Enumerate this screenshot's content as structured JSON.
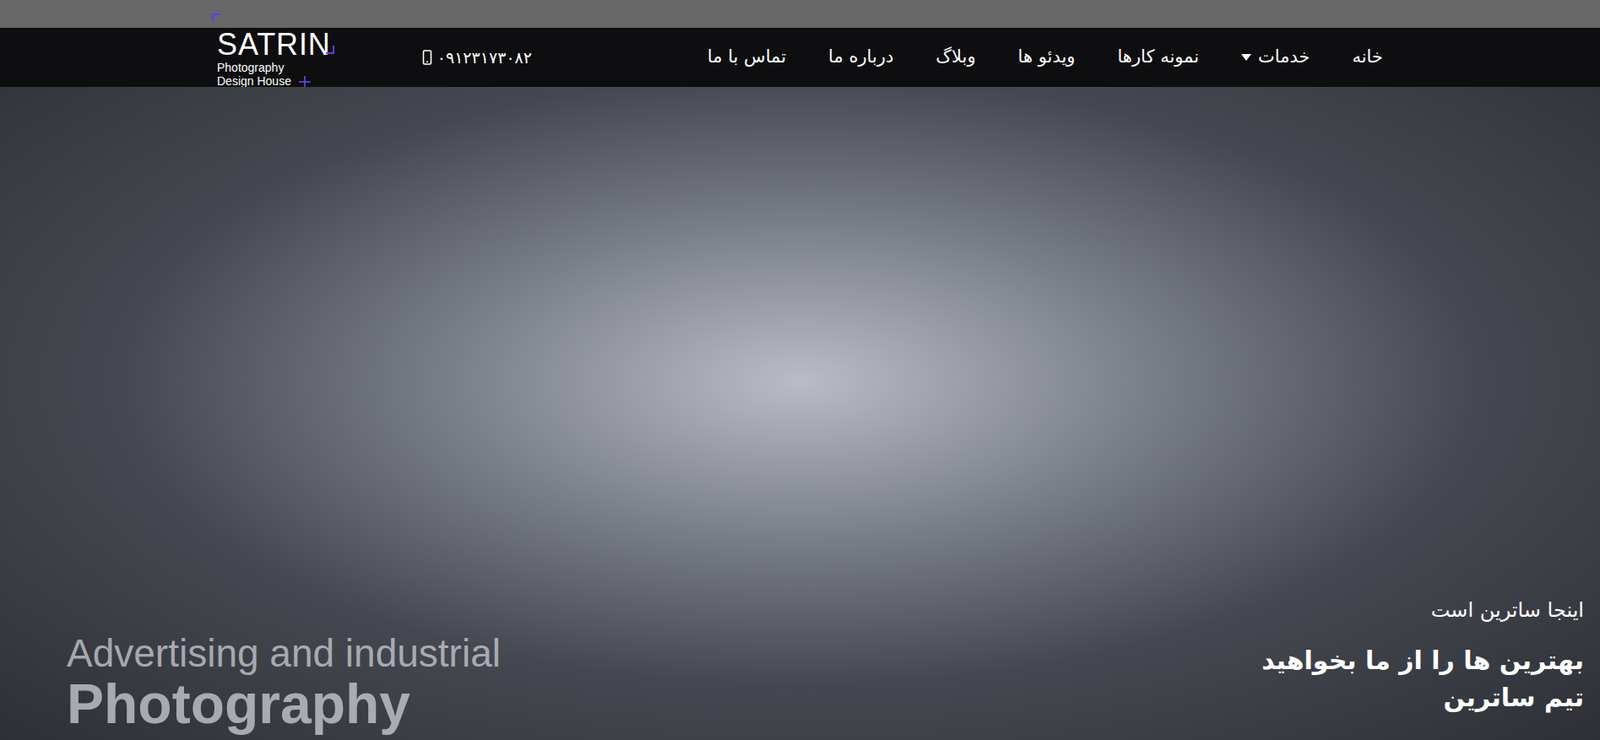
{
  "logo": {
    "name": "SATRIN",
    "tagline": [
      "Photography",
      "Design House"
    ]
  },
  "phone": "۰۹۱۲۳۱۷۳۰۸۲",
  "nav": [
    {
      "label": "خانه",
      "dropdown": false
    },
    {
      "label": "خدمات",
      "dropdown": true
    },
    {
      "label": "نمونه کارها",
      "dropdown": false
    },
    {
      "label": "ویدئو ها",
      "dropdown": false
    },
    {
      "label": "وبلاگ",
      "dropdown": false
    },
    {
      "label": "درباره ما",
      "dropdown": false
    },
    {
      "label": "تماس با ما",
      "dropdown": false
    }
  ],
  "hero": {
    "eyebrow": "اینجا ساترین است",
    "headline": [
      "بهترین ها را از ما بخواهید",
      "تیم ساترین"
    ],
    "caption": [
      "Advertising and industrial",
      "Photography"
    ]
  }
}
